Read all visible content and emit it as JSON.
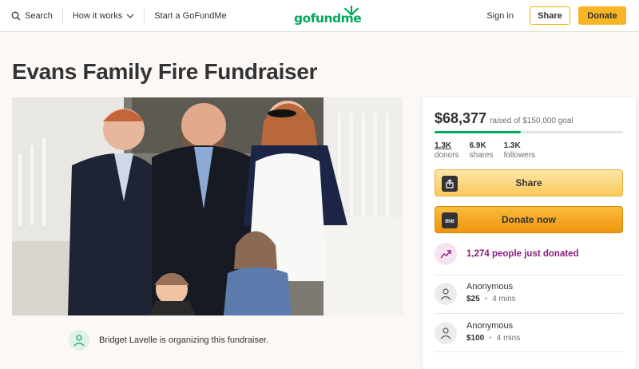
{
  "nav": {
    "search": "Search",
    "how_it_works": "How it works",
    "start": "Start a GoFundMe",
    "logo": "gofundme",
    "sign_in": "Sign in",
    "share": "Share",
    "donate": "Donate"
  },
  "title": "Evans Family Fire Fundraiser",
  "organizer": {
    "text": "Bridget Lavelle is organizing this fundraiser."
  },
  "panel": {
    "raised_amount": "$68,377",
    "raised_goal": "raised of $150,000 goal",
    "progress_fraction": 0.456,
    "stats": [
      {
        "value": "1.3K",
        "label": "donors"
      },
      {
        "value": "6.9K",
        "label": "shares"
      },
      {
        "value": "1.3K",
        "label": "followers"
      }
    ],
    "share_label": "Share",
    "donate_label": "Donate now",
    "donate_icon_text": "me",
    "trend_text": "1,274 people just donated",
    "donations": [
      {
        "name": "Anonymous",
        "amount": "$25",
        "time": "4 mins"
      },
      {
        "name": "Anonymous",
        "amount": "$100",
        "time": "4 mins"
      }
    ]
  },
  "colors": {
    "brand_green": "#02a95c",
    "donate_orange": "#f7b425",
    "trend_purple": "#8b1b7d"
  }
}
